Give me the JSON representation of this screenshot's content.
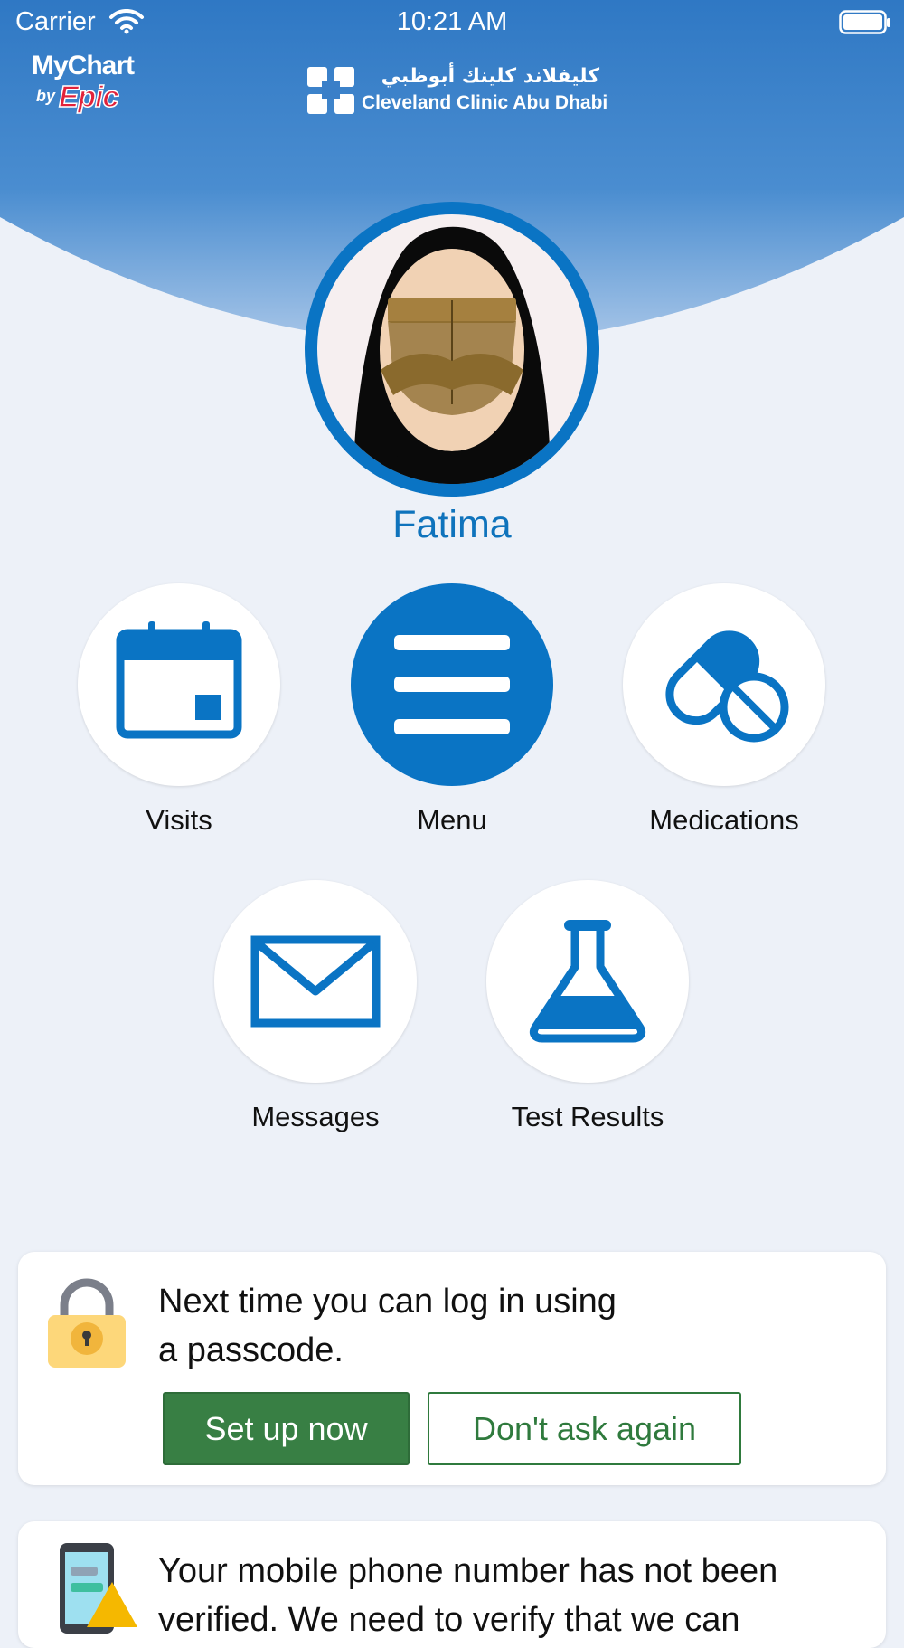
{
  "colors": {
    "header_top": "#2f78c4",
    "header_bottom": "#a8c6e8",
    "accent": "#0a74c4",
    "background": "#edf1f8",
    "primary_button": "#387f44"
  },
  "status_bar": {
    "carrier": "Carrier",
    "time": "10:21 AM"
  },
  "logos": {
    "mychart_text": "MyChart",
    "mychart_by": "by",
    "mychart_epic": "Epic",
    "clinic_arabic": "كليفلاند كلينك أبوظبي",
    "clinic_english": "Cleveland Clinic Abu Dhabi"
  },
  "patient": {
    "name": "Fatima"
  },
  "activities": [
    {
      "label": "Visits",
      "icon": "calendar-icon"
    },
    {
      "label": "Menu",
      "icon": "hamburger-menu-icon"
    },
    {
      "label": "Medications",
      "icon": "pill-icon"
    },
    {
      "label": "Messages",
      "icon": "envelope-icon"
    },
    {
      "label": "Test Results",
      "icon": "flask-icon"
    }
  ],
  "passcode_card": {
    "message_line1": "Next time you can log in using",
    "message_line2": "a passcode.",
    "primary_button": "Set up now",
    "secondary_button": "Don't ask again"
  },
  "phone_card": {
    "message_line1": "Your mobile phone number has not been",
    "message_line2": "verified. We need to verify that we can"
  }
}
